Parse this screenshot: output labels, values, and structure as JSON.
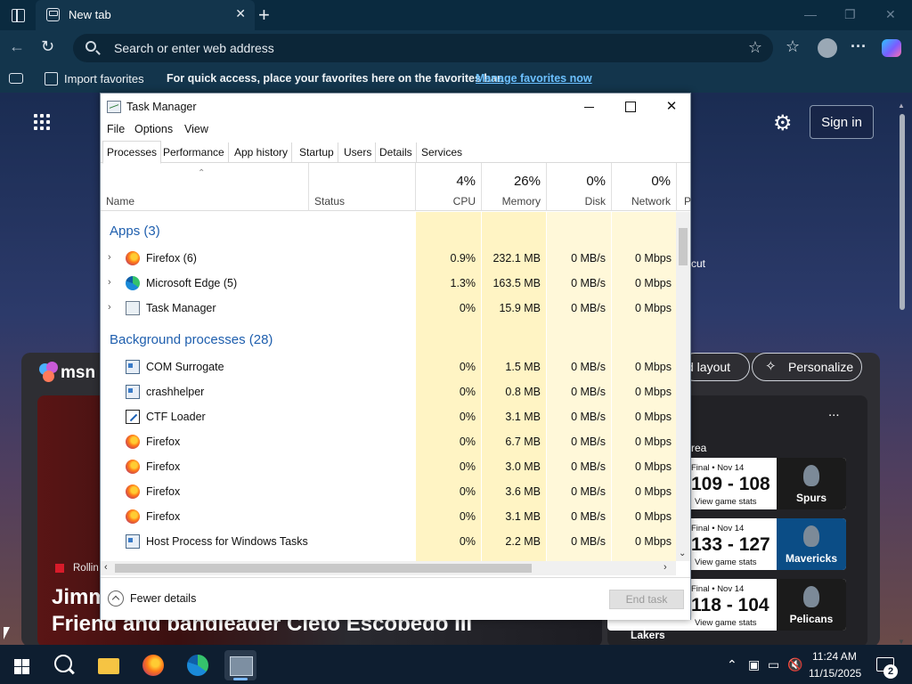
{
  "browser": {
    "tab_title": "New tab",
    "tab_close": "✕",
    "new_tab": "+",
    "window_controls": {
      "minimize": "—",
      "restore": "❐",
      "close": "✕"
    },
    "address_placeholder": "Search or enter web address",
    "favorites_bar": {
      "import_label": "Import favorites",
      "hint": "For quick access, place your favorites here on the favorites bar.",
      "manage_link": "Manage favorites now"
    }
  },
  "newtab": {
    "sign_in": "Sign in",
    "shortcut_fragment": "cut",
    "msn_logo": "msn",
    "layout_button": "d layout",
    "personalize_button": "Personalize",
    "hero_source": "Rollin",
    "hero_title": "Jimm\nFriend and bandleader Cleto Escobedo III",
    "sports_more": "...",
    "sports_area": "rea",
    "games": [
      {
        "status": "Final • Nov 14",
        "score": "109 - 108",
        "stats": "View game stats",
        "team": "Spurs"
      },
      {
        "status": "Final • Nov 14",
        "score": "133 - 127",
        "stats": "View game stats",
        "team": "Mavericks"
      },
      {
        "status": "Final • Nov 14",
        "score": "118 - 104",
        "stats": "View game stats",
        "team": "Pelicans",
        "other_team": "Lakers"
      }
    ]
  },
  "taskmgr": {
    "title": "Task Manager",
    "menu": [
      "File",
      "Options",
      "View"
    ],
    "tabs": [
      "Processes",
      "Performance",
      "App history",
      "Startup",
      "Users",
      "Details",
      "Services"
    ],
    "active_tab": "Processes",
    "columns": {
      "name": "Name",
      "status": "Status",
      "cpu_pct": "4%",
      "cpu": "CPU",
      "mem_pct": "26%",
      "mem": "Memory",
      "disk_pct": "0%",
      "disk": "Disk",
      "net_pct": "0%",
      "net": "Network",
      "power_fragment": "P"
    },
    "groups": {
      "apps": "Apps (3)",
      "background": "Background processes (28)"
    },
    "apps": [
      {
        "name": "Firefox (6)",
        "icon": "firefox-icon",
        "cpu": "0.9%",
        "mem": "232.1 MB",
        "disk": "0 MB/s",
        "net": "0 Mbps"
      },
      {
        "name": "Microsoft Edge (5)",
        "icon": "edge-icon",
        "cpu": "1.3%",
        "mem": "163.5 MB",
        "disk": "0 MB/s",
        "net": "0 Mbps"
      },
      {
        "name": "Task Manager",
        "icon": "task-manager-icon",
        "cpu": "0%",
        "mem": "15.9 MB",
        "disk": "0 MB/s",
        "net": "0 Mbps"
      }
    ],
    "background": [
      {
        "name": "COM Surrogate",
        "icon": "service-icon",
        "cpu": "0%",
        "mem": "1.5 MB",
        "disk": "0 MB/s",
        "net": "0 Mbps"
      },
      {
        "name": "crashhelper",
        "icon": "service-icon",
        "cpu": "0%",
        "mem": "0.8 MB",
        "disk": "0 MB/s",
        "net": "0 Mbps"
      },
      {
        "name": "CTF Loader",
        "icon": "ctf-loader-icon",
        "cpu": "0%",
        "mem": "3.1 MB",
        "disk": "0 MB/s",
        "net": "0 Mbps"
      },
      {
        "name": "Firefox",
        "icon": "firefox-icon",
        "cpu": "0%",
        "mem": "6.7 MB",
        "disk": "0 MB/s",
        "net": "0 Mbps"
      },
      {
        "name": "Firefox",
        "icon": "firefox-icon",
        "cpu": "0%",
        "mem": "3.0 MB",
        "disk": "0 MB/s",
        "net": "0 Mbps"
      },
      {
        "name": "Firefox",
        "icon": "firefox-icon",
        "cpu": "0%",
        "mem": "3.6 MB",
        "disk": "0 MB/s",
        "net": "0 Mbps"
      },
      {
        "name": "Firefox",
        "icon": "firefox-icon",
        "cpu": "0%",
        "mem": "3.1 MB",
        "disk": "0 MB/s",
        "net": "0 Mbps"
      },
      {
        "name": "Host Process for Windows Tasks",
        "icon": "service-icon",
        "cpu": "0%",
        "mem": "2.2 MB",
        "disk": "0 MB/s",
        "net": "0 Mbps"
      }
    ],
    "fewer_details": "Fewer details",
    "end_task": "End task"
  },
  "taskbar": {
    "time": "11:24 AM",
    "date": "11/15/2025",
    "notification_count": "2"
  }
}
